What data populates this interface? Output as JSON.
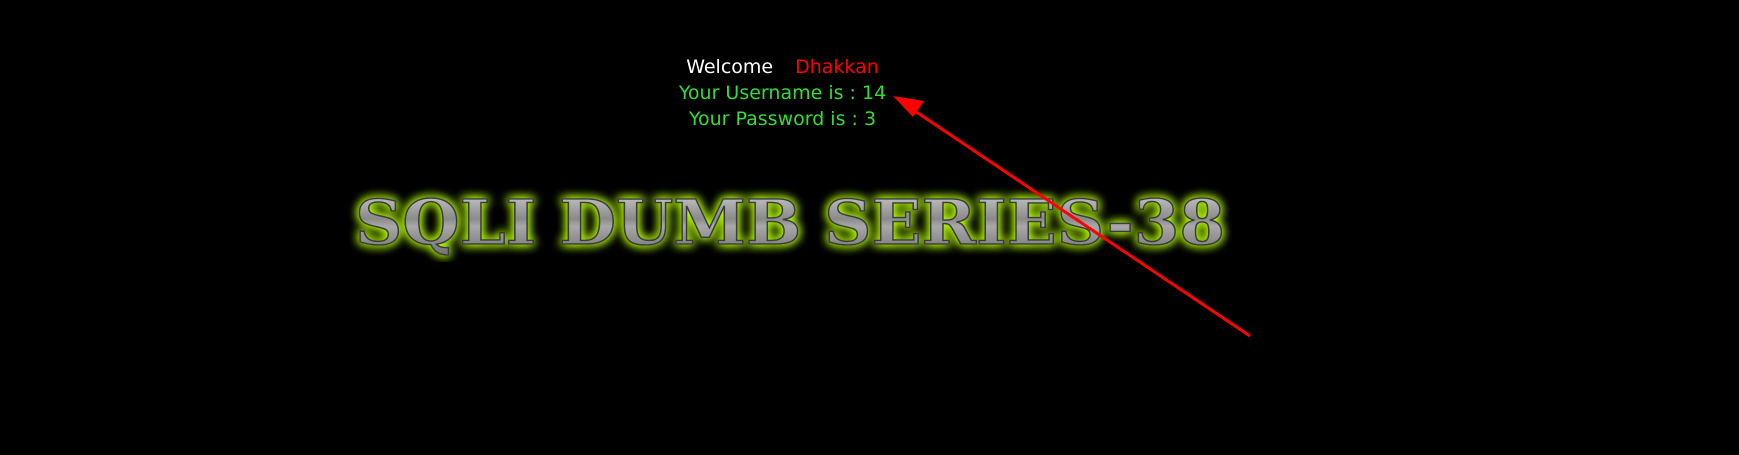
{
  "welcome": {
    "label": "Welcome",
    "name": "Dhakkan"
  },
  "result": {
    "username_line": "Your Username is : 14",
    "password_line": "Your Password is : 3"
  },
  "banner": {
    "title": "SQLI DUMB SERIES-38"
  },
  "colors": {
    "background": "#000000",
    "welcome_text": "#ffffff",
    "name_text": "#ff0000",
    "info_text": "#33dd33",
    "banner_glow": "#b8ff00",
    "annotation_arrow": "#ff0000"
  }
}
